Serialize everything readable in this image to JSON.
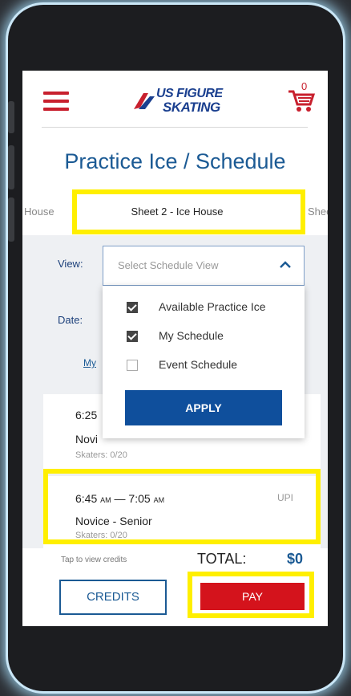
{
  "header": {
    "logo_line1": "US FIGURE",
    "logo_line2": "SKATING",
    "cart_count": "0"
  },
  "page_title": "Practice Ice / Schedule",
  "tabs": {
    "left": "House",
    "center": "Sheet 2 - Ice House",
    "right": "Sheet"
  },
  "filters": {
    "view_label": "View:",
    "view_placeholder": "Select Schedule View",
    "date_label": "Date:",
    "my_link": "My"
  },
  "dropdown": {
    "options": [
      {
        "label": "Available Practice Ice",
        "checked": true
      },
      {
        "label": "My Schedule",
        "checked": true
      },
      {
        "label": "Event Schedule",
        "checked": false
      }
    ],
    "apply_label": "APPLY"
  },
  "sessions": [
    {
      "time": "6:25",
      "level": "Novi",
      "skaters": "Skaters: 0/20"
    },
    {
      "time_start": "6:45",
      "time_start_suffix": "AM",
      "dash": "—",
      "time_end": "7:05",
      "time_end_suffix": "AM",
      "type": "UPI",
      "level": "Novice - Senior",
      "skaters": "Skaters: 0/20"
    }
  ],
  "footer": {
    "tap_text": "Tap to view credits",
    "total_label": "TOTAL:",
    "total_value": "$0",
    "credits_label": "CREDITS",
    "pay_label": "PAY"
  },
  "colors": {
    "accent_blue": "#1b5a94",
    "apply_blue": "#0f4f9c",
    "brand_red": "#c8202e",
    "pay_red": "#d4131c",
    "highlight_yellow": "#ffef00"
  }
}
